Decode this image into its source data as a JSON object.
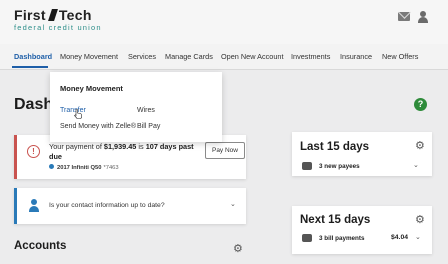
{
  "header": {
    "logo_left": "First",
    "logo_right": "Tech",
    "logo_sub": "federal credit union",
    "mail_icon": "mail-icon",
    "user_icon": "user-icon"
  },
  "nav": {
    "items": [
      {
        "label": "Dashboard"
      },
      {
        "label": "Money Movement"
      },
      {
        "label": "Services"
      },
      {
        "label": "Manage Cards"
      },
      {
        "label": "Open New Account"
      },
      {
        "label": "Investments"
      },
      {
        "label": "Insurance"
      },
      {
        "label": "New Offers"
      }
    ],
    "active": "Dashboard"
  },
  "dropdown": {
    "title": "Money Movement",
    "links": {
      "transfer": "Transfer",
      "wires": "Wires",
      "zelle": "Send Money with Zelle®",
      "billpay": "Bill Pay"
    }
  },
  "page": {
    "title": "Dash",
    "help": "?"
  },
  "alert": {
    "prefix": "Your payment of ",
    "amount": "$1,939.45",
    "middle": " is ",
    "days": "107 days past due",
    "vehicle": "2017 Infiniti Q50",
    "vehicle_num": "*7463",
    "button": "Pay Now"
  },
  "info": {
    "text": "Is your contact information up to date?"
  },
  "accounts": {
    "title": "Accounts"
  },
  "last15": {
    "title": "Last 15 days",
    "row": "3 new payees"
  },
  "next15": {
    "title": "Next 15 days",
    "row": "3 bill payments",
    "amount": "$4.04"
  },
  "colors": {
    "accent": "#1f5fa8",
    "alert": "#c9534f",
    "brand_teal": "#2f8f8a",
    "help_green": "#2e8b3a"
  }
}
